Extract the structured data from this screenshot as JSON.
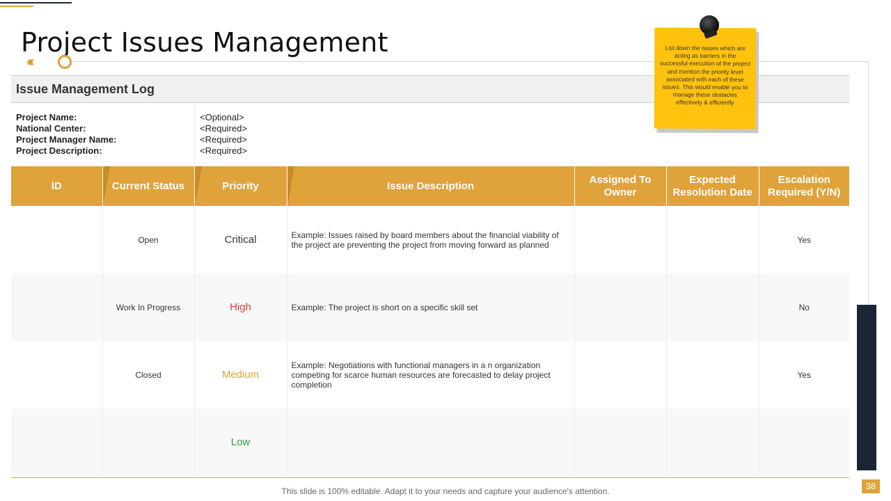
{
  "slide": {
    "title": "Project Issues Management",
    "page_number": "38",
    "footer": "This slide is 100% editable. Adapt it to your needs and capture your audience's attention."
  },
  "log": {
    "title": "Issue Management Log",
    "fields": [
      {
        "label": "Project Name:",
        "value": "<Optional>"
      },
      {
        "label": "National Center:",
        "value": "<Required>"
      },
      {
        "label": "Project Manager Name:",
        "value": "<Required>"
      },
      {
        "label": "Project Description:",
        "value": "<Required>"
      }
    ]
  },
  "table": {
    "headers": [
      "ID",
      "Current Status",
      "Priority",
      "Issue Description",
      "Assigned To Owner",
      "Expected Resolution Date",
      "Escalation Required (Y/N)"
    ],
    "rows": [
      {
        "id": "",
        "status": "Open",
        "priority": "Critical",
        "description": "Example: Issues raised by board members about the financial viability of the project are preventing the project from moving forward as planned",
        "owner": "",
        "date": "",
        "escalation": "Yes"
      },
      {
        "id": "",
        "status": "Work In Progress",
        "priority": "High",
        "description": "Example: The project is short on a specific skill set",
        "owner": "",
        "date": "",
        "escalation": "No"
      },
      {
        "id": "",
        "status": "Closed",
        "priority": "Medium",
        "description": "Example: Negotiations with functional managers in a n organization competing for scarce human resources are forecasted to delay project completion",
        "owner": "",
        "date": "",
        "escalation": "Yes"
      },
      {
        "id": "",
        "status": "",
        "priority": "Low",
        "description": "",
        "owner": "",
        "date": "",
        "escalation": ""
      }
    ]
  },
  "priority_colors": {
    "Critical": "#333333",
    "High": "#e03c3c",
    "Medium": "#e0a23a",
    "Low": "#2e9e4a"
  },
  "note": {
    "text": "List down the issues which are acting as barriers in the successful execution of the project and mention the priority level associated with each of these issues. This would enable you to manage these obstacles effectively & efficiently"
  },
  "colors": {
    "accent": "#e0a23a",
    "dark": "#1b2535",
    "note": "#ffc20e"
  }
}
